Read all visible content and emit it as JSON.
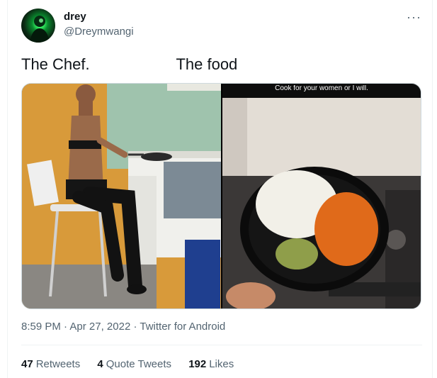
{
  "author": {
    "display_name": "drey",
    "handle": "@Dreymwangi"
  },
  "tweet": {
    "text": "The Chef.                    The food",
    "caption_overlay": "Cook for your women or I will."
  },
  "more_icon": "more-horizontal-icon",
  "meta": {
    "time": "8:59 PM",
    "separator": "·",
    "date": "Apr 27, 2022",
    "source": "Twitter for Android"
  },
  "stats": {
    "retweets_count": "47",
    "retweets_label": "Retweets",
    "quotes_count": "4",
    "quotes_label": "Quote Tweets",
    "likes_count": "192",
    "likes_label": "Likes"
  },
  "colors": {
    "text_primary": "#0f1419",
    "text_secondary": "#536471",
    "border": "#eff3f4"
  }
}
